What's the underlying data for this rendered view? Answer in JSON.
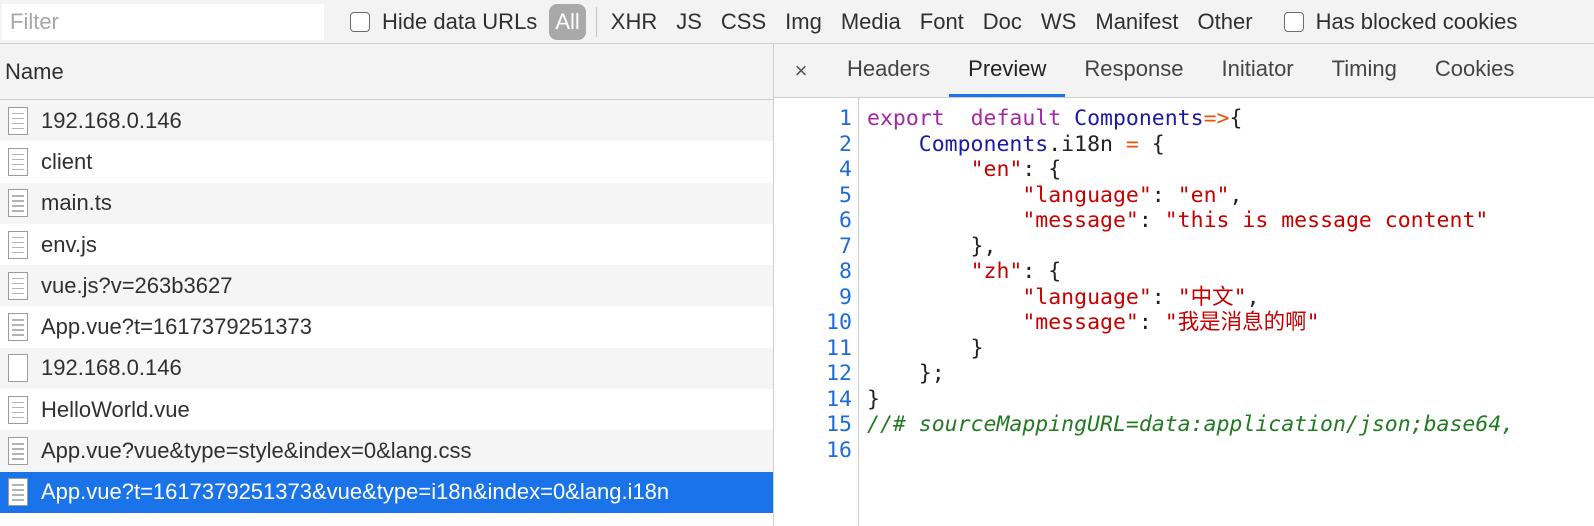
{
  "filter": {
    "placeholder": "Filter"
  },
  "hide_data_urls": {
    "label": "Hide data URLs",
    "checked": false
  },
  "types": {
    "all": "All",
    "items": [
      "XHR",
      "JS",
      "CSS",
      "Img",
      "Media",
      "Font",
      "Doc",
      "WS",
      "Manifest",
      "Other"
    ]
  },
  "has_blocked": {
    "label": "Has blocked cookies",
    "checked": false
  },
  "list": {
    "header": "Name",
    "rows": [
      {
        "name": "192.168.0.146",
        "icon": "document-icon"
      },
      {
        "name": "client",
        "icon": "document-icon"
      },
      {
        "name": "main.ts",
        "icon": "document-icon"
      },
      {
        "name": "env.js",
        "icon": "document-icon"
      },
      {
        "name": "vue.js?v=263b3627",
        "icon": "document-icon"
      },
      {
        "name": "App.vue?t=1617379251373",
        "icon": "document-icon"
      },
      {
        "name": "192.168.0.146",
        "icon": "blank-document-icon"
      },
      {
        "name": "HelloWorld.vue",
        "icon": "document-icon"
      },
      {
        "name": "App.vue?vue&type=style&index=0&lang.css",
        "icon": "document-icon"
      },
      {
        "name": "App.vue?t=1617379251373&vue&type=i18n&index=0&lang.i18n",
        "icon": "document-icon",
        "selected": true
      }
    ]
  },
  "detail": {
    "close": "×",
    "tabs": [
      "Headers",
      "Preview",
      "Response",
      "Initiator",
      "Timing",
      "Cookies"
    ],
    "active_tab": "Preview",
    "code": [
      {
        "n": "1",
        "seg": [
          [
            "kw",
            "export"
          ],
          [
            "",
            "  "
          ],
          [
            "kw",
            "default"
          ],
          [
            "",
            " "
          ],
          [
            "var",
            "Components"
          ],
          [
            "op",
            "=>"
          ],
          [
            "",
            "{"
          ]
        ]
      },
      {
        "n": "2",
        "seg": [
          [
            "",
            "    "
          ],
          [
            "var",
            "Components"
          ],
          [
            "",
            ".i18n "
          ],
          [
            "op",
            "="
          ],
          [
            "",
            " {"
          ]
        ]
      },
      {
        "n": "4",
        "seg": [
          [
            "",
            "        "
          ],
          [
            "str",
            "\"en\""
          ],
          [
            "",
            ": {"
          ]
        ]
      },
      {
        "n": "5",
        "seg": [
          [
            "",
            "            "
          ],
          [
            "str",
            "\"language\""
          ],
          [
            "",
            ": "
          ],
          [
            "str",
            "\"en\""
          ],
          [
            "",
            ","
          ]
        ]
      },
      {
        "n": "6",
        "seg": [
          [
            "",
            "            "
          ],
          [
            "str",
            "\"message\""
          ],
          [
            "",
            ": "
          ],
          [
            "str",
            "\"this is message content\""
          ]
        ]
      },
      {
        "n": "7",
        "seg": [
          [
            "",
            "        },"
          ]
        ]
      },
      {
        "n": "8",
        "seg": [
          [
            "",
            "        "
          ],
          [
            "str",
            "\"zh\""
          ],
          [
            "",
            ": {"
          ]
        ]
      },
      {
        "n": "9",
        "seg": [
          [
            "",
            "            "
          ],
          [
            "str",
            "\"language\""
          ],
          [
            "",
            ": "
          ],
          [
            "str",
            "\"中文\""
          ],
          [
            "",
            ","
          ]
        ]
      },
      {
        "n": "10",
        "seg": [
          [
            "",
            "            "
          ],
          [
            "str",
            "\"message\""
          ],
          [
            "",
            ": "
          ],
          [
            "str",
            "\"我是消息的啊\""
          ]
        ]
      },
      {
        "n": "11",
        "seg": [
          [
            "",
            "        }"
          ]
        ]
      },
      {
        "n": "12",
        "seg": [
          [
            "",
            "    };"
          ]
        ]
      },
      {
        "n": "14",
        "seg": [
          [
            "",
            "}"
          ]
        ]
      },
      {
        "n": "15",
        "seg": [
          [
            "cm",
            "//# sourceMappingURL=data:application/json;base64,"
          ]
        ]
      },
      {
        "n": "16",
        "seg": []
      }
    ]
  }
}
